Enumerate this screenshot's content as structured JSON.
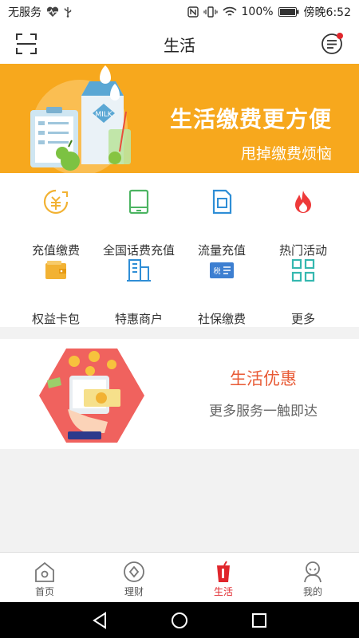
{
  "status_bar": {
    "carrier": "无服务",
    "battery": "100%",
    "time": "傍晚6:52"
  },
  "header": {
    "title": "生活"
  },
  "banner": {
    "headline": "生活缴费更方便",
    "subline": "甩掉缴费烦恼",
    "milk_label": "MILK"
  },
  "services": [
    {
      "label": "充值缴费",
      "icon": "recharge-icon"
    },
    {
      "label": "全国话费充值",
      "icon": "phone-icon"
    },
    {
      "label": "流量充值",
      "icon": "sim-card-icon"
    },
    {
      "label": "热门活动",
      "icon": "fire-icon"
    },
    {
      "label": "权益卡包",
      "icon": "wallet-icon"
    },
    {
      "label": "特惠商户",
      "icon": "building-icon"
    },
    {
      "label": "社保缴费",
      "icon": "tax-card-icon"
    },
    {
      "label": "更多",
      "icon": "grid-icon"
    }
  ],
  "tax_icon_text": "税",
  "promo": {
    "title": "生活优惠",
    "subtitle": "更多服务一触即达"
  },
  "tabs": [
    {
      "label": "首页",
      "icon": "home-icon"
    },
    {
      "label": "理财",
      "icon": "finance-icon"
    },
    {
      "label": "生活",
      "icon": "life-icon",
      "active": true
    },
    {
      "label": "我的",
      "icon": "profile-icon"
    }
  ],
  "colors": {
    "accent": "#e0262c",
    "banner": "#f7a81d",
    "promo_title": "#e85a35"
  }
}
